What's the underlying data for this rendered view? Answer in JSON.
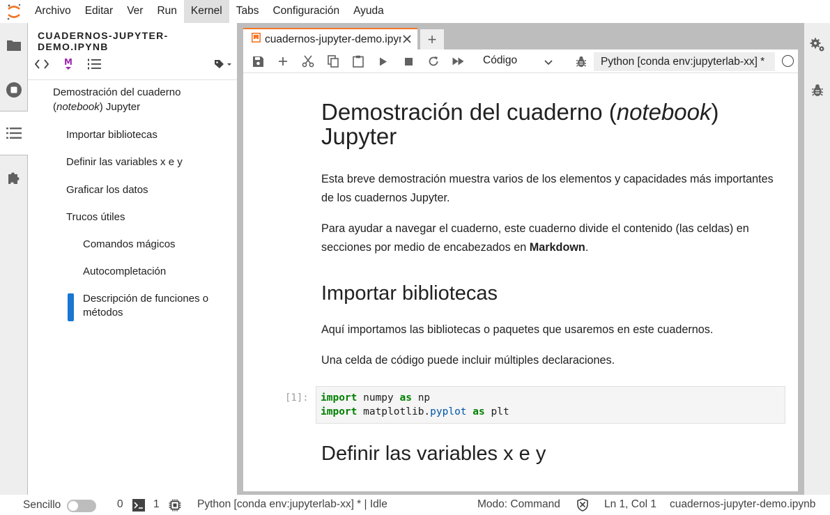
{
  "menu": {
    "items": [
      "Archivo",
      "Editar",
      "Ver",
      "Run",
      "Kernel",
      "Tabs",
      "Configuración",
      "Ayuda"
    ],
    "active": "Kernel"
  },
  "left_bar": {
    "icons": [
      "folder-icon",
      "running-stop-icon",
      "table-of-contents-icon",
      "extension-puzzle-icon"
    ],
    "active": "table-of-contents-icon"
  },
  "side_panel": {
    "title": "CUADERNOS-JUPYTER-DEMO.IPYNB",
    "toc": {
      "h1": {
        "pre": "Demostración del cuaderno",
        "paren_open": "(",
        "italic": "notebook",
        "post": ") Jupyter"
      },
      "items": [
        "Importar bibliotecas",
        "Definir las variables x e y",
        "Graficar los datos",
        "Trucos útiles",
        "Comandos mágicos",
        "Autocompletación",
        "Descripción de funciones o métodos"
      ]
    }
  },
  "tab": {
    "label": "cuadernos-jupyter-demo.ipynb",
    "new_tab": "+"
  },
  "toolbar": {
    "cell_type": "Código",
    "kernel": "Python [conda env:jupyterlab-xx] *"
  },
  "notebook": {
    "title_pre": "Demostración del cuaderno (",
    "title_italic": "notebook",
    "title_post": ")",
    "title_line2": "Jupyter",
    "intro": "Esta breve demostración muestra varios de los elementos y capacidades más importantes de los cuadernos Jupyter.",
    "nav_pre": "Para ayudar a navegar el cuaderno, este cuaderno divide el contenido (las celdas) en secciones por medio de encabezados en ",
    "nav_bold": "Markdown",
    "nav_post": ".",
    "section1": "Importar bibliotecas",
    "section1_p1": "Aquí importamos las bibliotecas o paquetes que usaremos en este cuadernos.",
    "section1_p2": "Una celda de código puede incluir múltiples declaraciones.",
    "prompt": "[1]:",
    "code": {
      "line1": {
        "kw1": "import",
        "mod": " numpy ",
        "kw2": "as",
        "alias": " np"
      },
      "line2": {
        "kw1": "import",
        "mod": " matplotlib.",
        "attr": "pyplot",
        "sp": " ",
        "kw2": "as",
        "alias": " plt"
      }
    },
    "section2": "Definir las variables x e y"
  },
  "statusbar": {
    "mode_label": "Sencillo",
    "terminals": "0",
    "kernels": "1",
    "kernel_status": "Python [conda env:jupyterlab-xx] * | Idle",
    "mode": "Modo: Command",
    "cursor": "Ln 1, Col 1",
    "filename": "cuadernos-jupyter-demo.ipynb"
  },
  "colors": {
    "accent": "#f37626",
    "toc_marker": "#1976d2",
    "markdown_icon": "#9c27b0",
    "keyword": "#008000"
  }
}
